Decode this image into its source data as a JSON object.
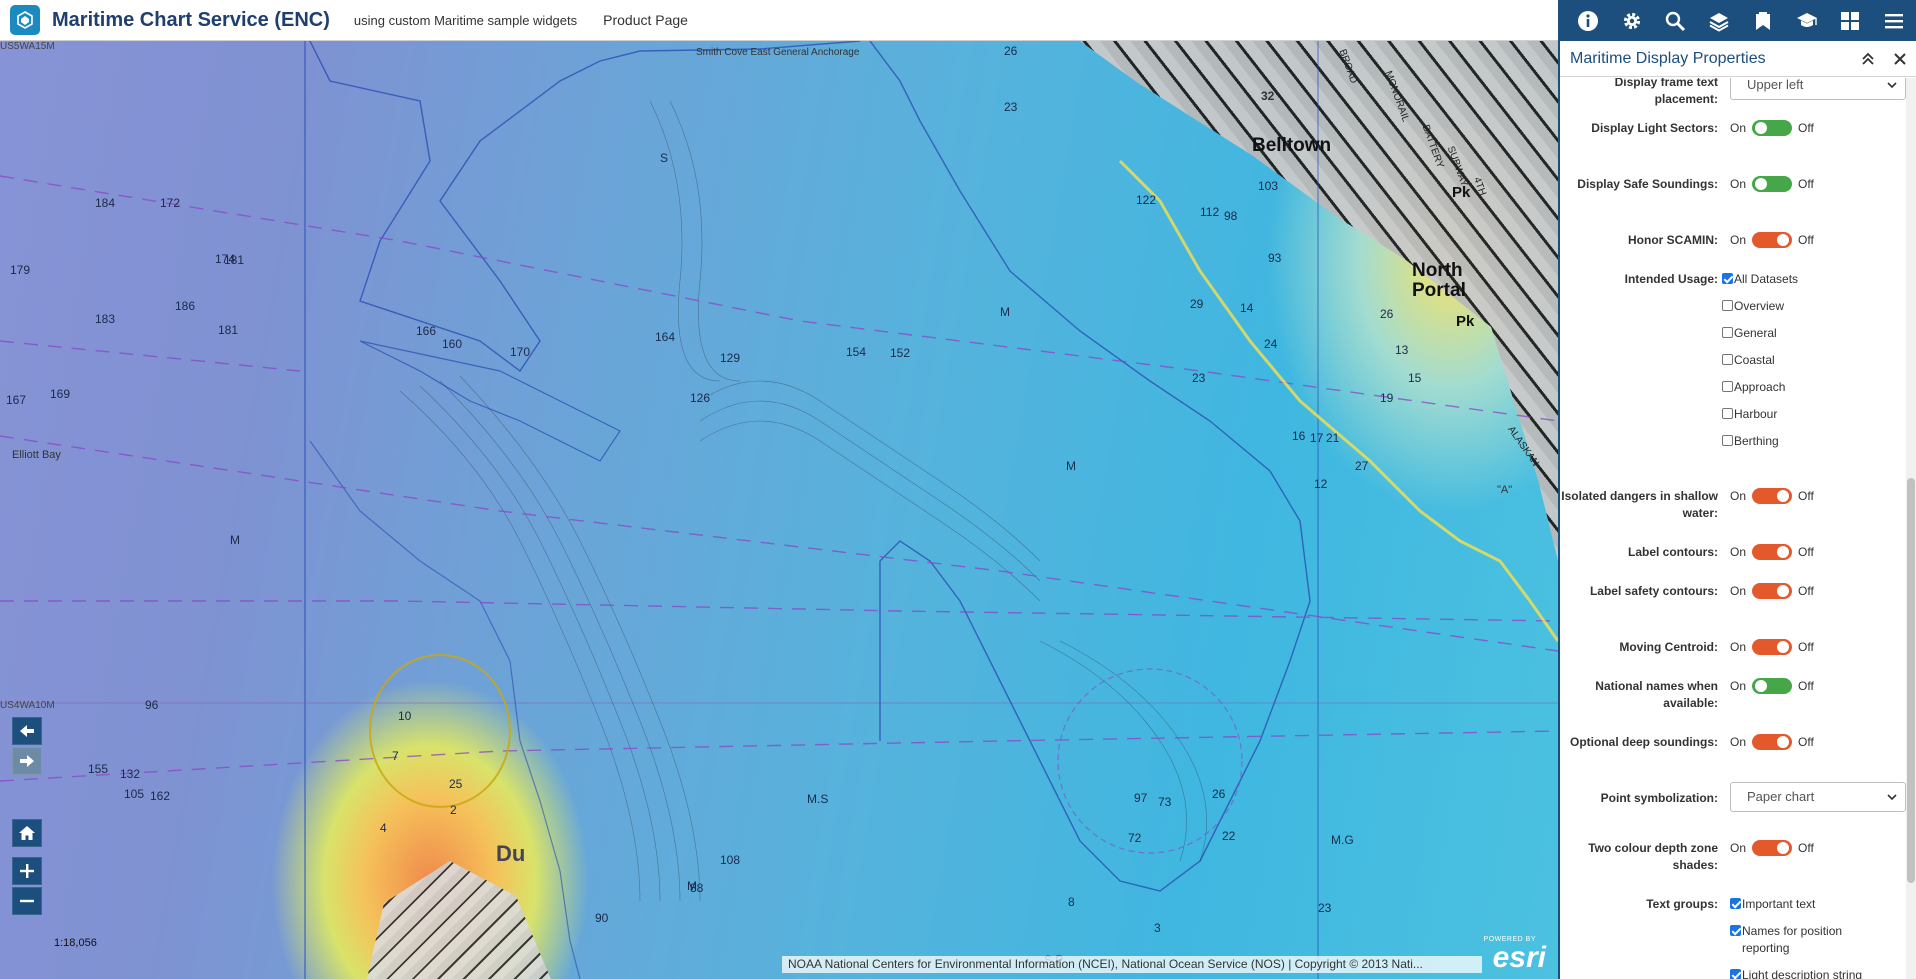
{
  "header": {
    "title": "Maritime Chart Service (ENC)",
    "subtitle": "using custom Maritime sample widgets",
    "product_link": "Product Page"
  },
  "toolbar": {
    "tools": [
      "info-icon",
      "gear-icon",
      "search-icon",
      "layers-icon",
      "bookmark-icon",
      "graduation-cap-icon",
      "grid-icon",
      "menu-icon"
    ]
  },
  "map": {
    "labels": {
      "cell1": "US5WA15M",
      "cell2": "US4WA10M",
      "smith_cove": "Smith Cove East General Anchorage",
      "elliott_bay": "Elliott Bay",
      "belltown": "Belltown",
      "north_portal": "North\nPortal",
      "pk1": "Pk",
      "pk2": "Pk",
      "duwamish": "Du",
      "street1": "BROAD",
      "street2": "MONORAIL",
      "street3": "BATTERY",
      "street4": "SUBWAY",
      "street5": "4TH",
      "street6": "ALASKAN",
      "num32": "32",
      "a_label": "\"A\""
    },
    "soundings": [
      "26",
      "23",
      "184",
      "172",
      "181",
      "174",
      "179",
      "186",
      "183",
      "181",
      "169",
      "167",
      "166",
      "160",
      "170",
      "164",
      "154",
      "152",
      "129",
      "126",
      "132",
      "155",
      "162",
      "105",
      "96",
      "90",
      "88",
      "108",
      "103",
      "122",
      "112",
      "98",
      "93",
      "29",
      "26",
      "21",
      "27",
      "24",
      "23",
      "14",
      "12",
      "13",
      "15",
      "16",
      "17",
      "19",
      "10",
      "7",
      "4",
      "2",
      "25",
      "97",
      "73",
      "72",
      "23",
      "22",
      "26",
      "3",
      "8",
      "M",
      "M",
      "M",
      "M",
      "S",
      "M.S",
      "M.G",
      "S.P"
    ],
    "scale": "1:18,056",
    "attribution": "NOAA National Centers for Environmental Information (NCEI), National Ocean Service (NOS) | Copyright © 2013 Nati...",
    "esri_powered": "POWERED BY",
    "esri_word": "esri"
  },
  "panel": {
    "title": "Maritime Display Properties",
    "on_label": "On",
    "off_label": "Off",
    "rows": {
      "frame_text": {
        "label": "Display frame text placement:",
        "value": "Upper left"
      },
      "light_sectors": {
        "label": "Display Light Sectors:",
        "state": "on"
      },
      "safe_soundings": {
        "label": "Display Safe Soundings:",
        "state": "on"
      },
      "scamin": {
        "label": "Honor SCAMIN:",
        "state": "off"
      },
      "intended_usage": {
        "label": "Intended Usage:",
        "options": [
          {
            "label": "All Datasets",
            "checked": true
          },
          {
            "label": "Overview",
            "checked": false
          },
          {
            "label": "General",
            "checked": false
          },
          {
            "label": "Coastal",
            "checked": false
          },
          {
            "label": "Approach",
            "checked": false
          },
          {
            "label": "Harbour",
            "checked": false
          },
          {
            "label": "Berthing",
            "checked": false
          }
        ]
      },
      "isolated_dangers": {
        "label": "Isolated dangers in shallow water:",
        "state": "off"
      },
      "label_contours": {
        "label": "Label contours:",
        "state": "off"
      },
      "label_safety": {
        "label": "Label safety contours:",
        "state": "off"
      },
      "moving_centroid": {
        "label": "Moving Centroid:",
        "state": "off"
      },
      "national_names": {
        "label": "National names when available:",
        "state": "on"
      },
      "deep_soundings": {
        "label": "Optional deep soundings:",
        "state": "off"
      },
      "point_symbolization": {
        "label": "Point symbolization:",
        "value": "Paper chart"
      },
      "two_colour": {
        "label": "Two colour depth zone shades:",
        "state": "off"
      },
      "text_groups": {
        "label": "Text groups:",
        "options": [
          {
            "label": "Important text",
            "checked": true
          },
          {
            "label": "Names for position reporting",
            "checked": true
          },
          {
            "label": "Light description string",
            "checked": true
          }
        ]
      }
    }
  },
  "colors": {
    "brand_blue": "#1c4e7e",
    "toggle_on": "#45a747",
    "toggle_off": "#e4592c",
    "checkbox": "#1a73e8"
  }
}
